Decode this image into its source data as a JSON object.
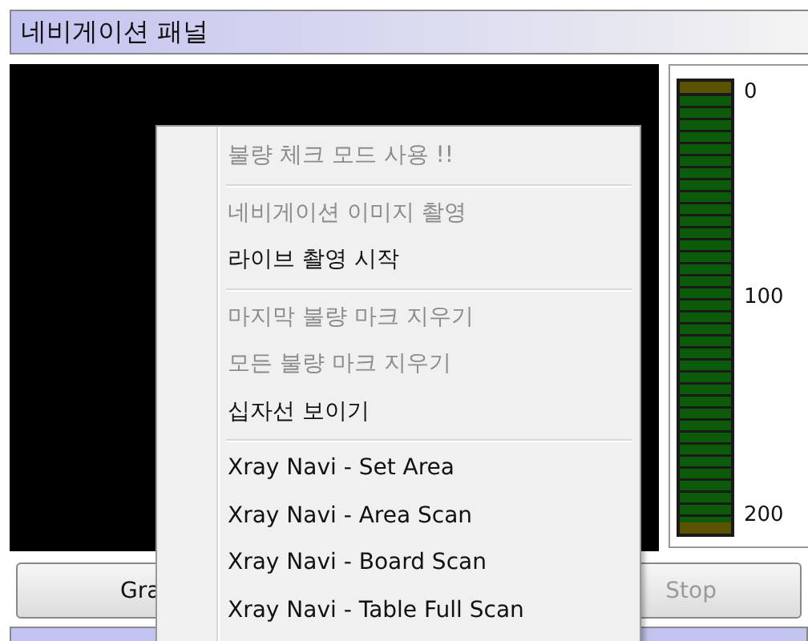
{
  "panel": {
    "title": "네비게이션 패널"
  },
  "gauge": {
    "labels": [
      "0",
      "100",
      "200"
    ]
  },
  "buttons": [
    {
      "label": "Gra",
      "disabled": false
    },
    {
      "label": "Stop",
      "disabled": true
    }
  ],
  "context_menu": [
    {
      "kind": "item",
      "label": "불량 체크 모드 사용 !!",
      "disabled": true
    },
    {
      "kind": "separator"
    },
    {
      "kind": "item",
      "label": "네비게이션 이미지 촬영",
      "disabled": true
    },
    {
      "kind": "item",
      "label": "라이브 촬영 시작",
      "disabled": false
    },
    {
      "kind": "separator"
    },
    {
      "kind": "item",
      "label": "마지막 불량 마크 지우기",
      "disabled": true
    },
    {
      "kind": "item",
      "label": "모든 불량 마크 지우기",
      "disabled": true
    },
    {
      "kind": "item",
      "label": "십자선 보이기",
      "disabled": false
    },
    {
      "kind": "separator"
    },
    {
      "kind": "item",
      "label": "Xray Navi - Set Area",
      "disabled": false
    },
    {
      "kind": "item",
      "label": "Xray Navi - Area Scan",
      "disabled": false
    },
    {
      "kind": "item",
      "label": "Xray Navi - Board Scan",
      "disabled": false
    },
    {
      "kind": "item",
      "label": "Xray Navi - Table Full Scan",
      "disabled": false
    }
  ]
}
